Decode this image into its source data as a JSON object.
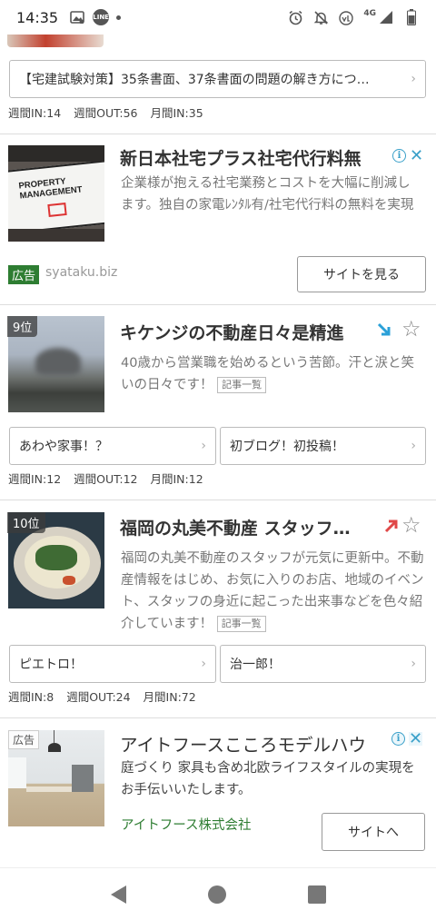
{
  "status_bar": {
    "time": "14:35",
    "network": "4G",
    "left_icons": [
      "gallery-icon",
      "line-icon",
      "dot-icon"
    ],
    "right_icons": [
      "alarm-icon",
      "bell-off-icon",
      "volte-icon",
      "signal-icon",
      "battery-icon"
    ],
    "line_text": "LINE"
  },
  "top_entry": {
    "link": "【宅建試験対策】35条書面、37条書面の問題の解き方につ…",
    "stats": [
      "週間IN:14",
      "週間OUT:56",
      "月間IN:35"
    ]
  },
  "ad1": {
    "title": "新日本社宅プラス社宅代行料無",
    "desc": "企業様が抱える社宅業務とコストを大幅に削減します。独自の家電ﾚﾝﾀﾙ有/社宅代行料の無料を実現",
    "label": "広告",
    "domain": "syataku.biz",
    "button": "サイトを見る",
    "thumb_lines": [
      "PROPERTY",
      "MANAGEMENT"
    ]
  },
  "rank9": {
    "rank": "9位",
    "title": "キケンジの不動産日々是精進",
    "desc": "40歳から営業職を始めるという苦節。汗と涙と笑いの日々です！",
    "kiji": "記事一覧",
    "links": [
      "あわや家事！？",
      "初ブログ！初投稿！"
    ],
    "stats": [
      "週間IN:12",
      "週間OUT:12",
      "月間IN:12"
    ],
    "trend_color": "#2aa0d8"
  },
  "rank10": {
    "rank": "10位",
    "title": "福岡の丸美不動産 スタッフ…",
    "desc": "福岡の丸美不動産のスタッフが元気に更新中。不動産情報をはじめ、お気に入りのお店、地域のイベント、スタッフの身近に起こった出来事などを色々紹介しています！",
    "kiji": "記事一覧",
    "links": [
      "ピエトロ！",
      "治一郎！"
    ],
    "stats": [
      "週間IN:8",
      "週間OUT:24",
      "月間IN:72"
    ],
    "trend_color": "#e04848"
  },
  "ad2": {
    "label": "広告",
    "title": "アイトフースこころモデルハウ",
    "desc": "庭づくり 家具も含め北欧ライフスタイルの実現をお手伝いいたします。",
    "company": "アイトフース株式会社",
    "button": "サイトへ"
  },
  "colors": {
    "ad_green": "#2e7d32",
    "adchoice_blue": "#3aa0c9",
    "company_green": "#2e7d32"
  },
  "star": "☆"
}
